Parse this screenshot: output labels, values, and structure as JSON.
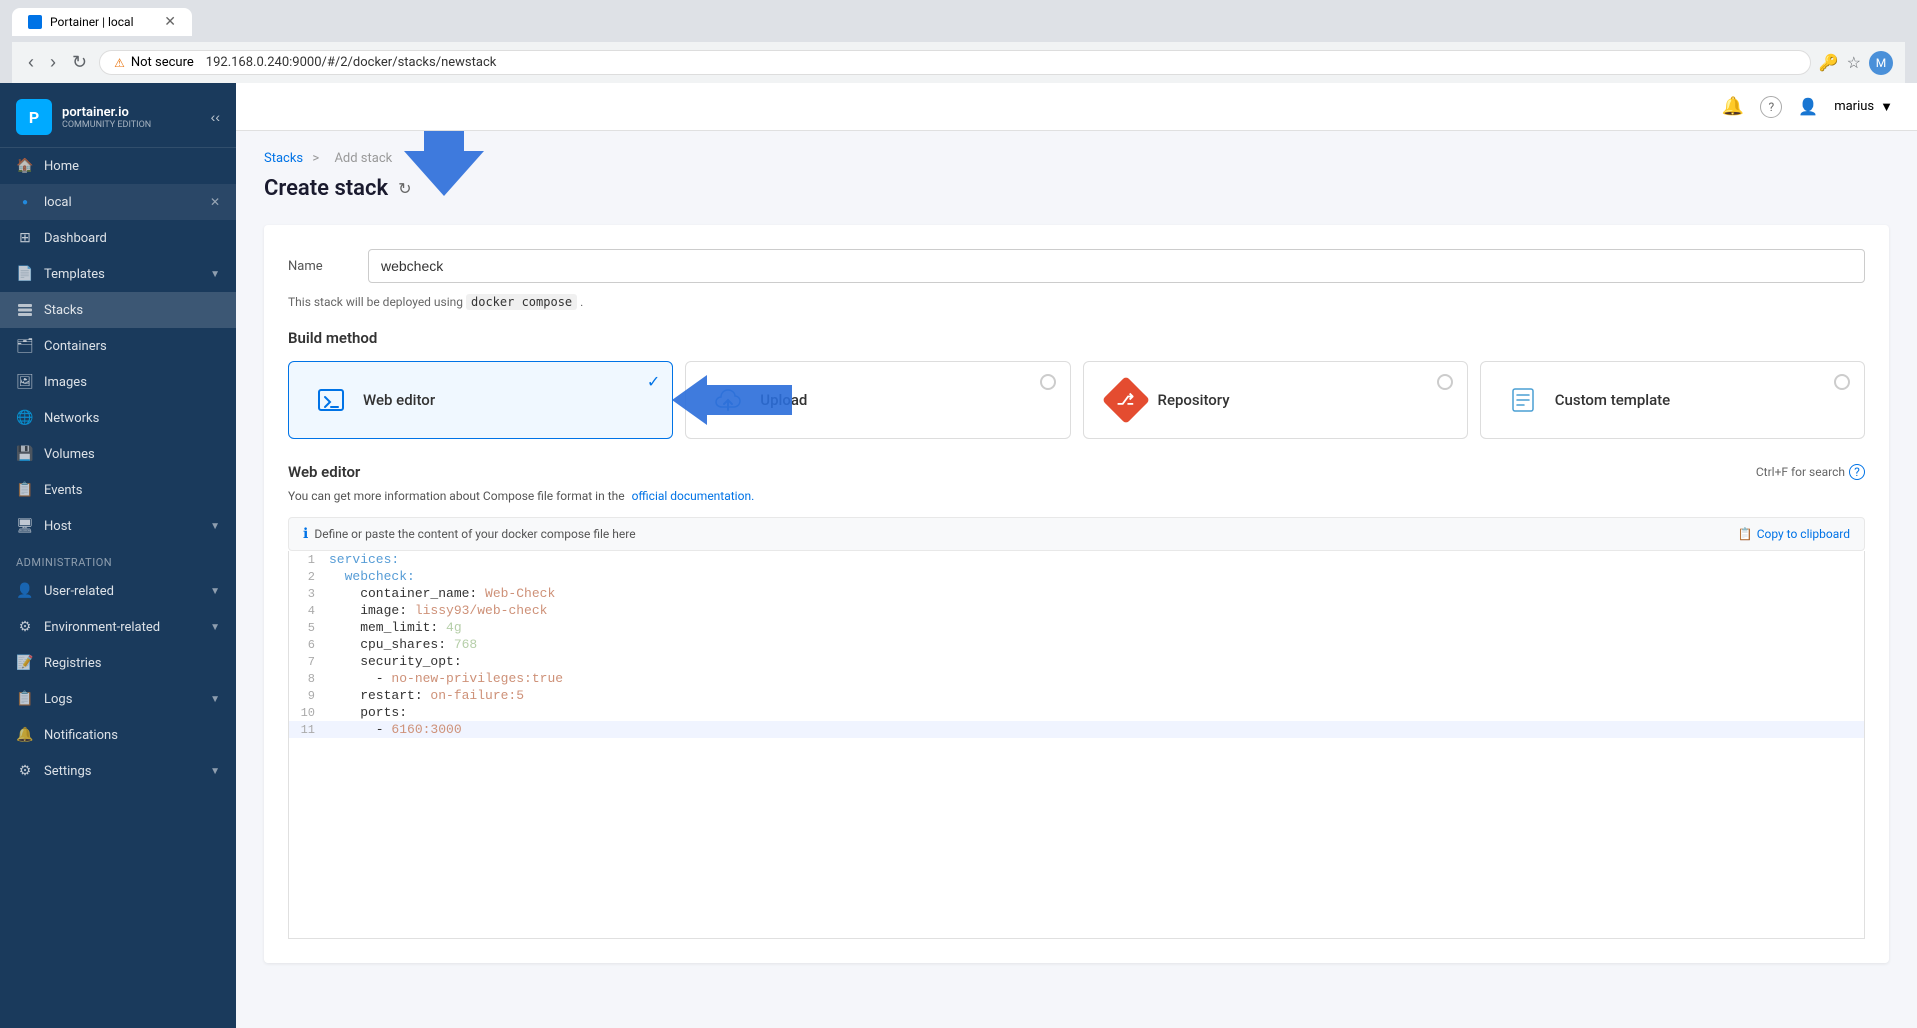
{
  "browser": {
    "tab_title": "Portainer | local",
    "url": "192.168.0.240:9000/#/2/docker/stacks/newstack",
    "url_warning": "Not secure"
  },
  "sidebar": {
    "logo_text": "portainer.io",
    "logo_sub": "COMMUNITY EDITION",
    "items": [
      {
        "id": "home",
        "label": "Home",
        "icon": "🏠"
      },
      {
        "id": "local",
        "label": "local",
        "icon": "●",
        "env": true
      },
      {
        "id": "dashboard",
        "label": "Dashboard",
        "icon": "⊞"
      },
      {
        "id": "templates",
        "label": "Templates",
        "icon": "📄",
        "chevron": true
      },
      {
        "id": "stacks",
        "label": "Stacks",
        "icon": "📦",
        "active": true
      },
      {
        "id": "containers",
        "label": "Containers",
        "icon": "🗂"
      },
      {
        "id": "images",
        "label": "Images",
        "icon": "🖼"
      },
      {
        "id": "networks",
        "label": "Networks",
        "icon": "🌐"
      },
      {
        "id": "volumes",
        "label": "Volumes",
        "icon": "💾"
      },
      {
        "id": "events",
        "label": "Events",
        "icon": "📋"
      },
      {
        "id": "host",
        "label": "Host",
        "icon": "🖥",
        "chevron": true
      }
    ],
    "admin_section": "Administration",
    "admin_items": [
      {
        "id": "user-related",
        "label": "User-related",
        "icon": "👤",
        "chevron": true
      },
      {
        "id": "environment-related",
        "label": "Environment-related",
        "icon": "⚙",
        "chevron": true
      },
      {
        "id": "registries",
        "label": "Registries",
        "icon": "📝"
      },
      {
        "id": "logs",
        "label": "Logs",
        "icon": "📋",
        "chevron": true
      },
      {
        "id": "notifications",
        "label": "Notifications",
        "icon": "🔔"
      },
      {
        "id": "settings",
        "label": "Settings",
        "icon": "⚙",
        "chevron": true
      }
    ]
  },
  "topbar": {
    "notification_icon": "🔔",
    "help_icon": "?",
    "user_icon": "👤",
    "username": "marius"
  },
  "page": {
    "breadcrumb_stacks": "Stacks",
    "breadcrumb_separator": ">",
    "breadcrumb_current": "Add stack",
    "title": "Create stack",
    "name_label": "Name",
    "name_value": "webcheck",
    "deploy_note": "This stack will be deployed using",
    "deploy_code": "docker compose",
    "deploy_note_end": ".",
    "build_method_title": "Build method",
    "build_methods": [
      {
        "id": "web-editor",
        "label": "Web editor",
        "selected": true
      },
      {
        "id": "upload",
        "label": "Upload",
        "selected": false
      },
      {
        "id": "repository",
        "label": "Repository",
        "selected": false
      },
      {
        "id": "custom-template",
        "label": "Custom template",
        "selected": false
      }
    ],
    "editor_title": "Web editor",
    "ctrl_f_hint": "Ctrl+F for search",
    "editor_note": "You can get more information about Compose file format in the",
    "editor_link": "official documentation.",
    "info_bar_text": "Define or paste the content of your docker compose file here",
    "copy_clipboard": "Copy to clipboard",
    "code_lines": [
      {
        "num": "1",
        "content": "services:"
      },
      {
        "num": "2",
        "content": "  webcheck:"
      },
      {
        "num": "3",
        "content": "    container_name: Web-Check"
      },
      {
        "num": "4",
        "content": "    image: lissy93/web-check"
      },
      {
        "num": "5",
        "content": "    mem_limit: 4g"
      },
      {
        "num": "6",
        "content": "    cpu_shares: 768"
      },
      {
        "num": "7",
        "content": "    security_opt:"
      },
      {
        "num": "8",
        "content": "      - no-new-privileges:true"
      },
      {
        "num": "9",
        "content": "    restart: on-failure:5"
      },
      {
        "num": "10",
        "content": "    ports:"
      },
      {
        "num": "11",
        "content": "      - 6160:3000"
      }
    ]
  }
}
